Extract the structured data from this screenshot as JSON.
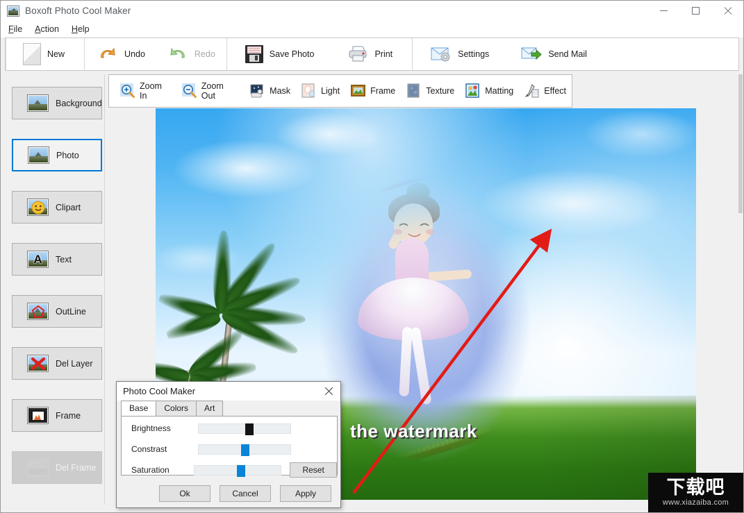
{
  "window": {
    "title": "Boxoft Photo Cool Maker",
    "icon": "photo-app-icon",
    "controls": {
      "minimize": "minimize",
      "maximize": "maximize",
      "close": "close"
    }
  },
  "menubar": {
    "items": [
      {
        "label": "File",
        "accel": "F"
      },
      {
        "label": "Action",
        "accel": "A"
      },
      {
        "label": "Help",
        "accel": "H"
      }
    ]
  },
  "toolbar": {
    "groups": [
      {
        "items": [
          {
            "label": "New",
            "icon": "new-page-icon",
            "disabled": false
          }
        ]
      },
      {
        "items": [
          {
            "label": "Undo",
            "icon": "undo-arrow-icon",
            "disabled": false
          },
          {
            "label": "Redo",
            "icon": "redo-arrow-icon",
            "disabled": true
          }
        ]
      },
      {
        "items": [
          {
            "label": "Save Photo",
            "icon": "floppy-disk-icon",
            "disabled": false
          },
          {
            "label": "Print",
            "icon": "printer-icon",
            "disabled": false
          }
        ]
      },
      {
        "items": [
          {
            "label": "Settings",
            "icon": "mail-gear-icon",
            "disabled": false
          },
          {
            "label": "Send Mail",
            "icon": "mail-send-icon",
            "disabled": false
          }
        ]
      }
    ]
  },
  "sidebar": {
    "items": [
      {
        "label": "Background",
        "icon": "image-thumb-icon",
        "selected": false,
        "disabled": false
      },
      {
        "label": "Photo",
        "icon": "image-thumb-icon",
        "selected": true,
        "disabled": false
      },
      {
        "label": "Clipart",
        "icon": "image-smiley-icon",
        "selected": false,
        "disabled": false
      },
      {
        "label": "Text",
        "icon": "image-letter-a-icon",
        "selected": false,
        "disabled": false
      },
      {
        "label": "OutLine",
        "icon": "image-outline-icon",
        "selected": false,
        "disabled": false
      },
      {
        "label": "Del Layer",
        "icon": "image-red-x-icon",
        "selected": false,
        "disabled": false
      },
      {
        "label": "Frame",
        "icon": "image-frame-icon",
        "selected": false,
        "disabled": false
      },
      {
        "label": "Del Frame",
        "icon": "image-del-frame-icon",
        "selected": false,
        "disabled": true
      }
    ]
  },
  "subtoolbar": {
    "items": [
      {
        "label": "Zoom In",
        "icon": "zoom-in-icon"
      },
      {
        "label": "Zoom Out",
        "icon": "zoom-out-icon"
      },
      {
        "label": "Mask",
        "icon": "mask-icon"
      },
      {
        "label": "Light",
        "icon": "light-icon"
      },
      {
        "label": "Frame",
        "icon": "frame-icon"
      },
      {
        "label": "Texture",
        "icon": "texture-icon"
      },
      {
        "label": "Matting",
        "icon": "matting-icon"
      },
      {
        "label": "Effect",
        "icon": "effect-brush-icon"
      }
    ]
  },
  "canvas": {
    "watermark_text": "the watermark",
    "annotation": {
      "shape": "red-arrow",
      "color": "#e31b16"
    }
  },
  "site_watermark": {
    "brand": "下载吧",
    "url": "www.xiazaiba.com"
  },
  "dialog": {
    "title": "Photo Cool Maker",
    "close_label": "close",
    "tabs": [
      {
        "label": "Base",
        "active": true
      },
      {
        "label": "Colors",
        "active": false
      },
      {
        "label": "Art",
        "active": false
      }
    ],
    "sliders": [
      {
        "label": "Brightness",
        "value": 58,
        "thumb": "dark"
      },
      {
        "label": "Constrast",
        "value": 50,
        "thumb": "blue"
      },
      {
        "label": "Saturation",
        "value": 50,
        "thumb": "blue"
      }
    ],
    "reset_label": "Reset",
    "buttons": [
      {
        "label": "Ok"
      },
      {
        "label": "Cancel"
      },
      {
        "label": "Apply"
      }
    ]
  },
  "colors": {
    "accent": "#0078d7",
    "annotation_red": "#e31b16",
    "slider_blue": "#0a84d8",
    "window_bg": "#f0f0f0"
  }
}
